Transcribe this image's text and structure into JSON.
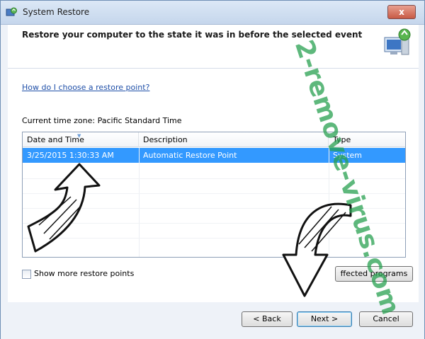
{
  "window": {
    "title": "System Restore",
    "close_glyph": "x"
  },
  "header": {
    "headline": "Restore your computer to the state it was in before the selected event",
    "icon": "system-restore-icon"
  },
  "help_link": "How do I choose a restore point?",
  "timezone_label": "Current time zone: Pacific Standard Time",
  "table": {
    "columns": [
      "Date and Time",
      "Description",
      "Type"
    ],
    "rows": [
      {
        "date_time": "3/25/2015 1:30:33 AM",
        "description": "Automatic Restore Point",
        "type": "System"
      }
    ],
    "selected_row": 0,
    "sort_column": "Date and Time"
  },
  "show_more_label": "Show more restore points",
  "show_more_checked": false,
  "scan_button": "ffected programs",
  "buttons": {
    "back": "< Back",
    "next": "Next >",
    "cancel": "Cancel"
  },
  "watermark": "2-remove-virus.com",
  "colors": {
    "selection": "#3399ff",
    "link": "#1f4fa8",
    "watermark": "#28a050"
  }
}
